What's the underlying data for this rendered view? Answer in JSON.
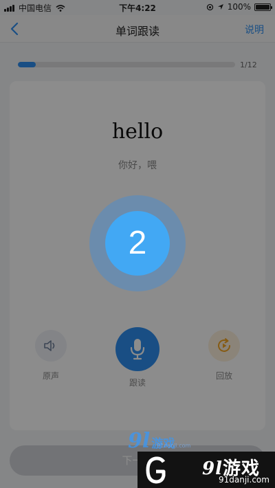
{
  "status_bar": {
    "carrier": "中国电信",
    "time": "下午4:22",
    "battery_text": "100%"
  },
  "nav": {
    "title": "单词跟读",
    "help_label": "说明"
  },
  "progress": {
    "current": 1,
    "total": 12,
    "label": "1/12"
  },
  "word_card": {
    "word": "hello",
    "meaning": "你好，喂"
  },
  "controls": {
    "original_label": "原声",
    "record_label": "跟读",
    "playback_label": "回放"
  },
  "next_button": {
    "label": "下一个"
  },
  "countdown": {
    "value": "2"
  },
  "watermark": {
    "center_text": "游戏",
    "center_url": "91danji.com",
    "corner_text": "游戏",
    "corner_url": "91danji.com",
    "logo_number": "9l"
  },
  "colors": {
    "accent": "#2f8ff0",
    "countdown_core": "#42a8f4",
    "playback_accent": "#f5a623"
  }
}
